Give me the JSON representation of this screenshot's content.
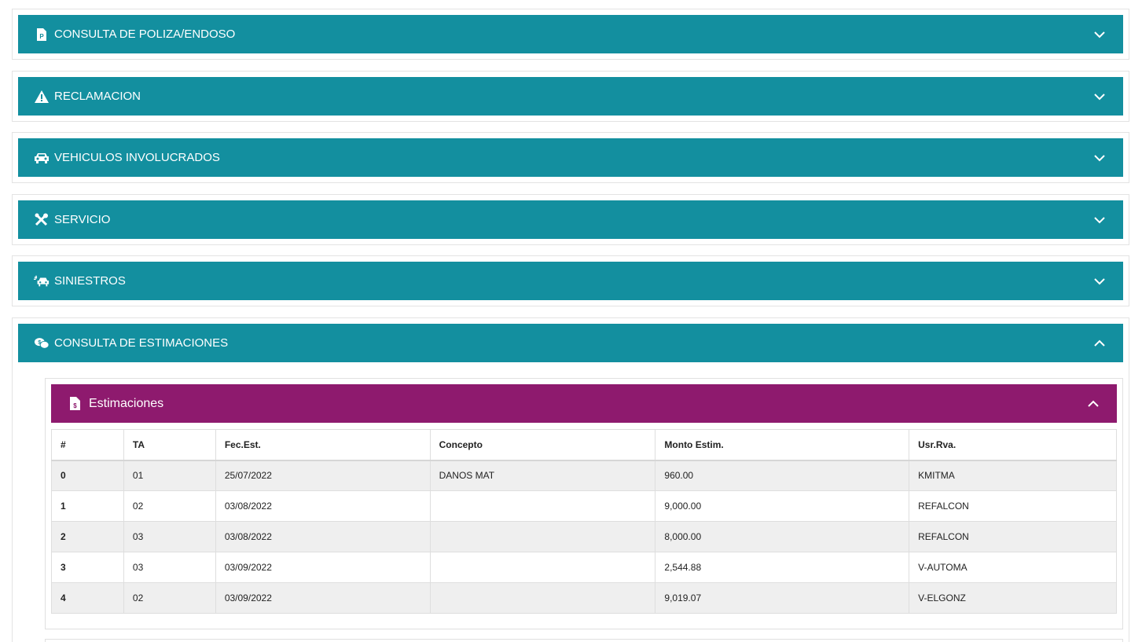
{
  "colors": {
    "accordion": "#138f9f",
    "subpanel": "#8e1a6e"
  },
  "sections": [
    {
      "icon": "policy-document-icon",
      "title": "CONSULTA DE POLIZA/ENDOSO",
      "expanded": false
    },
    {
      "icon": "warning-icon",
      "title": "RECLAMACION",
      "expanded": false
    },
    {
      "icon": "car-icon",
      "title": "VEHICULOS INVOLUCRADOS",
      "expanded": false
    },
    {
      "icon": "tools-icon",
      "title": "SERVICIO",
      "expanded": false
    },
    {
      "icon": "car-crash-icon",
      "title": "SINIESTROS",
      "expanded": false
    },
    {
      "icon": "money-comments-icon",
      "title": "CONSULTA DE ESTIMACIONES",
      "expanded": true
    }
  ],
  "estimaciones": {
    "icon": "invoice-dollar-icon",
    "title": "Estimaciones",
    "columns": [
      "#",
      "TA",
      "Fec.Est.",
      "Concepto",
      "Monto Estim.",
      "Usr.Rva."
    ],
    "rows": [
      [
        "0",
        "01",
        "25/07/2022",
        "DANOS MAT",
        "960.00",
        "KMITMA"
      ],
      [
        "1",
        "02",
        "03/08/2022",
        "",
        "9,000.00",
        "REFALCON"
      ],
      [
        "2",
        "03",
        "03/08/2022",
        "",
        "8,000.00",
        "REFALCON"
      ],
      [
        "3",
        "03",
        "03/09/2022",
        "",
        "2,544.88",
        "V-AUTOMA"
      ],
      [
        "4",
        "02",
        "03/09/2022",
        "",
        "9,019.07",
        "V-ELGONZ"
      ]
    ]
  }
}
